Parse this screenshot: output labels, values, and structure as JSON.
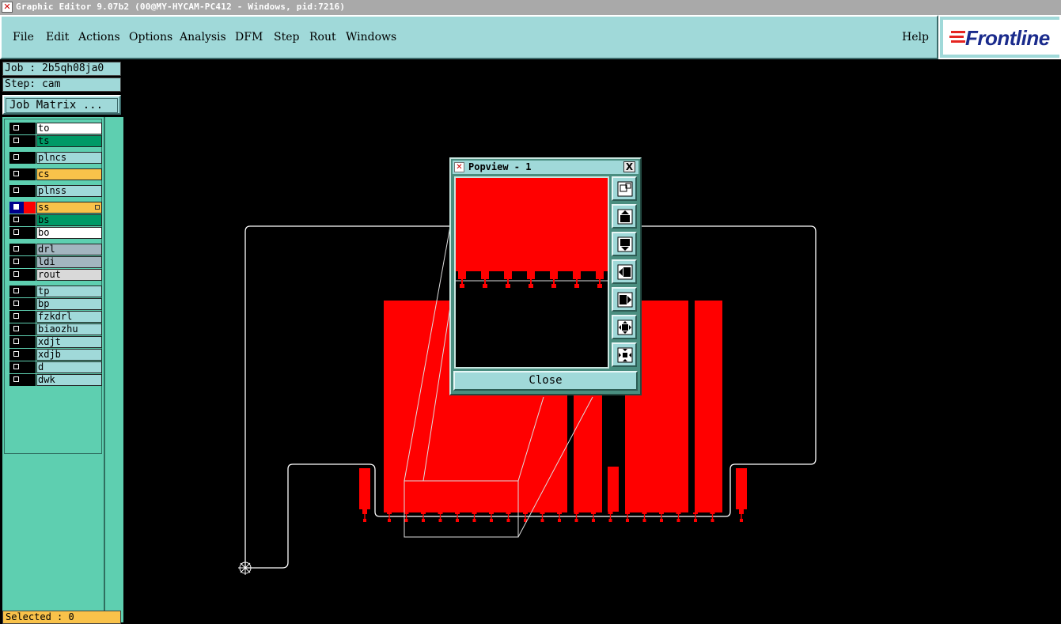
{
  "window": {
    "title": "Graphic Editor 9.07b2 (00@MY-HYCAM-PC412 - Windows, pid:7216)"
  },
  "menu": {
    "items": [
      "File",
      "Edit",
      "Actions",
      "Options",
      "Analysis",
      "DFM",
      "Step",
      "Rout",
      "Windows"
    ],
    "help": "Help",
    "logo": "Frontline"
  },
  "job": {
    "job_label": "Job : 2b5qh08ja0",
    "step_label": "Step: cam",
    "matrix_button": "Job Matrix ..."
  },
  "layers": [
    {
      "name": "to",
      "color": "#ffffff"
    },
    {
      "name": "ts",
      "color": "#009966"
    },
    {
      "name": "plncs",
      "color": "#a0d9d9"
    },
    {
      "name": "cs",
      "color": "#f9c24a"
    },
    {
      "name": "plnss",
      "color": "#a0d9d9"
    },
    {
      "name": "ss",
      "color": "#f9c24a",
      "active": true,
      "display_color": "#ff0000"
    },
    {
      "name": "bs",
      "color": "#009966"
    },
    {
      "name": "bo",
      "color": "#ffffff"
    },
    {
      "name": "drl",
      "color": "#a3b5bf"
    },
    {
      "name": "ldi",
      "color": "#a3b5bf"
    },
    {
      "name": "rout",
      "color": "#d9d9d9"
    },
    {
      "name": "tp",
      "color": "#a0d9d9"
    },
    {
      "name": "bp",
      "color": "#a0d9d9"
    },
    {
      "name": "fzkdrl",
      "color": "#a0d9d9"
    },
    {
      "name": "biaozhu",
      "color": "#a0d9d9"
    },
    {
      "name": "xdjt",
      "color": "#a0d9d9"
    },
    {
      "name": "xdjb",
      "color": "#a0d9d9"
    },
    {
      "name": "d",
      "color": "#a0d9d9"
    },
    {
      "name": "dwk",
      "color": "#a0d9d9"
    }
  ],
  "status": {
    "selected": "Selected : 0"
  },
  "popview": {
    "title": "Popview - 1",
    "close_x": "X",
    "close_button": "Close",
    "tools": [
      "zoom-fit-icon",
      "pan-up-icon",
      "pan-down-icon",
      "pan-left-icon",
      "pan-right-icon",
      "zoom-out-icon",
      "zoom-in-icon"
    ]
  },
  "colors": {
    "feature": "#ff0000",
    "panel": "#a0d9d9",
    "layer_bg": "#5ecfb0"
  }
}
